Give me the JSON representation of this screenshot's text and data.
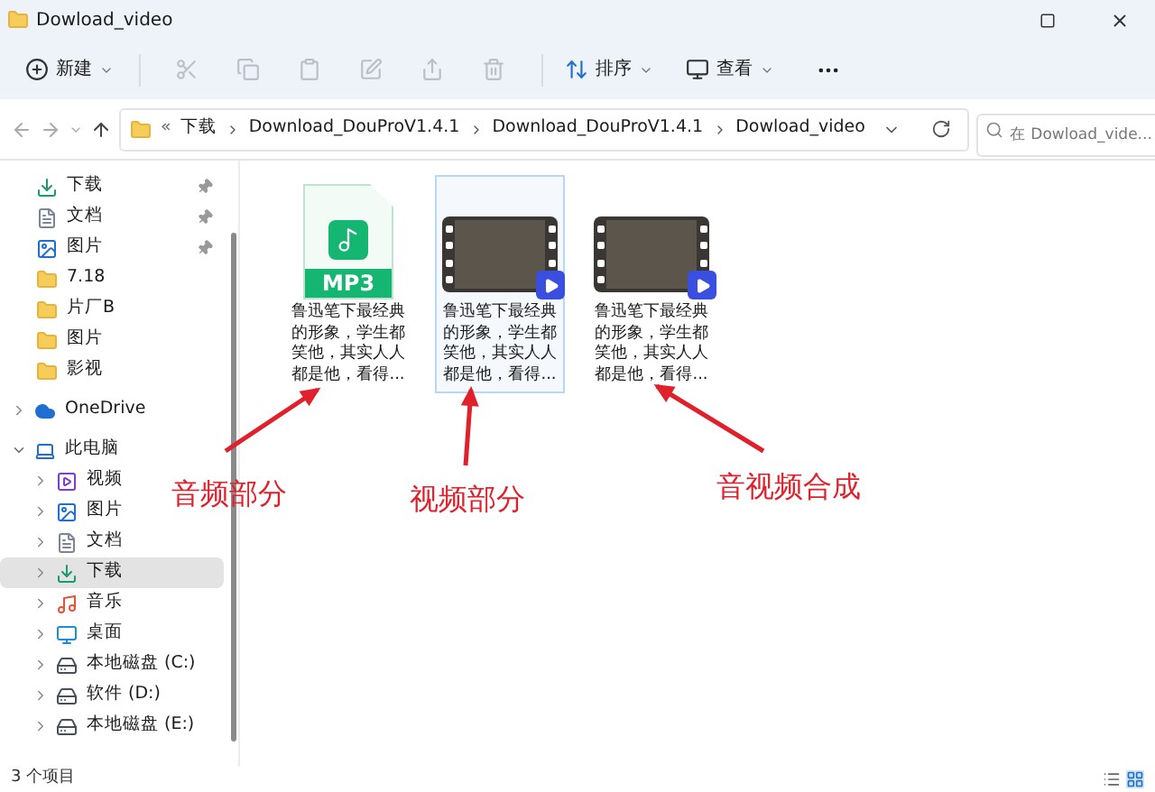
{
  "window": {
    "title": "Dowload_video"
  },
  "toolbar": {
    "new_label": "新建",
    "sort_label": "排序",
    "view_label": "查看"
  },
  "address_bar": {
    "overflow": "«",
    "path": [
      "下载",
      "Download_DouProV1.4.1",
      "Download_DouProV1.4.1",
      "Dowload_video"
    ]
  },
  "search": {
    "placeholder": "在 Dowload_vide..."
  },
  "sidebar": {
    "items": [
      {
        "label": "下载",
        "kind": "download",
        "pinned": true,
        "selected": false
      },
      {
        "label": "文档",
        "kind": "document",
        "pinned": true,
        "selected": false
      },
      {
        "label": "图片",
        "kind": "picture",
        "pinned": true,
        "selected": false
      },
      {
        "label": "7.18",
        "kind": "folder",
        "pinned": false,
        "selected": false
      },
      {
        "label": "片厂B",
        "kind": "folder",
        "pinned": false,
        "selected": false
      },
      {
        "label": "图片",
        "kind": "folder",
        "pinned": false,
        "selected": false
      },
      {
        "label": "影视",
        "kind": "folder",
        "pinned": false,
        "selected": false
      },
      {
        "label": "OneDrive",
        "kind": "cloud",
        "expanded": false,
        "selected": false
      },
      {
        "label": "此电脑",
        "kind": "pc",
        "expanded": true,
        "selected": false,
        "children": [
          {
            "label": "视频",
            "kind": "video",
            "expanded": false,
            "selected": false
          },
          {
            "label": "图片",
            "kind": "picture",
            "expanded": false,
            "selected": false
          },
          {
            "label": "文档",
            "kind": "document",
            "expanded": false,
            "selected": false
          },
          {
            "label": "下载",
            "kind": "download",
            "expanded": false,
            "selected": true
          },
          {
            "label": "音乐",
            "kind": "music",
            "expanded": false,
            "selected": false
          },
          {
            "label": "桌面",
            "kind": "desktop",
            "expanded": false,
            "selected": false
          },
          {
            "label": "本地磁盘 (C:)",
            "kind": "system-drive",
            "expanded": false,
            "selected": false
          },
          {
            "label": "软件 (D:)",
            "kind": "drive",
            "expanded": false,
            "selected": false
          },
          {
            "label": "本地磁盘 (E:)",
            "kind": "drive",
            "expanded": false,
            "selected": false
          }
        ]
      }
    ]
  },
  "files": [
    {
      "kind": "audio",
      "badge": "MP3",
      "name": "鲁迅笔下最经典的形象，学生都笑他，其实人人都是他，看得...",
      "selected": false
    },
    {
      "kind": "video",
      "name": "鲁迅笔下最经典的形象，学生都笑他，其实人人都是他，看得...",
      "selected": true
    },
    {
      "kind": "video",
      "name": "鲁迅笔下最经典的形象，学生都笑他，其实人人都是他，看得...",
      "selected": false
    }
  ],
  "annotations": [
    {
      "label": "音频部分"
    },
    {
      "label": "视频部分"
    },
    {
      "label": "音视频合成"
    }
  ],
  "status_bar": {
    "item_count": "3 个项目",
    "views": [
      {
        "kind": "details",
        "selected": false
      },
      {
        "kind": "large-icons",
        "selected": true
      }
    ]
  }
}
